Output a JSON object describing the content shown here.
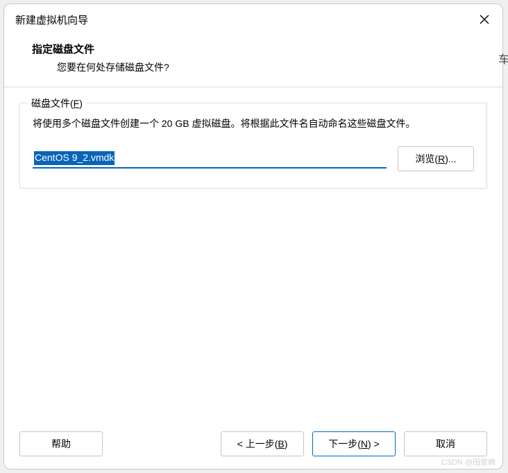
{
  "window": {
    "title": "新建虚拟机向导"
  },
  "header": {
    "title": "指定磁盘文件",
    "subtitle": "您要在何处存储磁盘文件?"
  },
  "group": {
    "label_prefix": "磁盘文件(",
    "label_mnemonic": "F",
    "label_suffix": ")",
    "description": "将使用多个磁盘文件创建一个 20 GB 虚拟磁盘。将根据此文件名自动命名这些磁盘文件。"
  },
  "file": {
    "value": "CentOS 9_2.vmdk",
    "browse_prefix": "浏览(",
    "browse_mnemonic": "R",
    "browse_suffix": ")..."
  },
  "buttons": {
    "help": "帮助",
    "back_prefix": "< 上一步(",
    "back_mnemonic": "B",
    "back_suffix": ")",
    "next_prefix": "下一步(",
    "next_mnemonic": "N",
    "next_suffix": ") >",
    "cancel": "取消"
  },
  "watermark": "CSDN @田俊楠",
  "edge_char": "车"
}
